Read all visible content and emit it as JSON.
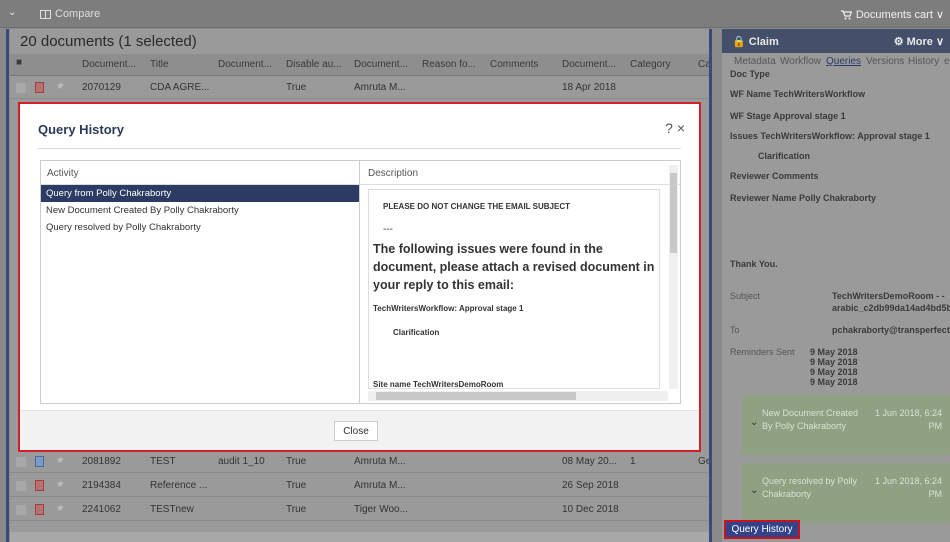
{
  "topbar": {
    "compare": "Compare",
    "cart": "Documents cart ∨",
    "collapse_glyph": "⌄",
    "cart_icon": "cart-icon"
  },
  "list": {
    "count": "20 documents (1 selected)",
    "columns": [
      "Document...",
      "Title",
      "Document...",
      "Disable au...",
      "Document...",
      "Reason fo...",
      "Comments",
      "Document...",
      "Category",
      "Ca"
    ],
    "top_rows": [
      [
        "2070129",
        "CDA AGRE...",
        "",
        "True",
        "Amruta M...",
        "",
        "",
        "18 Apr 2018",
        "",
        ""
      ]
    ],
    "bottom_rows": [
      [
        "2081892",
        "TEST",
        "audit 1_10",
        "True",
        "Amruta M...",
        "",
        "",
        "08 May 20...",
        "1",
        "Ge"
      ],
      [
        "2194384",
        "Reference ...",
        "",
        "True",
        "Amruta M...",
        "",
        "",
        "26 Sep 2018",
        "",
        ""
      ],
      [
        "2241062",
        "TESTnew",
        "",
        "True",
        "Tiger Woo...",
        "",
        "",
        "10 Dec 2018",
        "",
        ""
      ]
    ]
  },
  "panel": {
    "claim": "Claim",
    "more": "More ∨",
    "tabs": [
      "Metadata",
      "Workflow",
      "Queries",
      "Versions",
      "History",
      "e"
    ],
    "lines": [
      "Doc Type",
      "WF Name TechWritersWorkflow",
      "WF Stage Approval stage 1",
      "Issues TechWritersWorkflow: Approval stage 1",
      "Clarification",
      "Reviewer Comments",
      "Reviewer Name Polly Chakraborty",
      "Thank You."
    ],
    "subject_label": "Subject",
    "subject_value": [
      "TechWritersDemoRoom - -",
      "arabic_c2db99da14ad4bd5bf"
    ],
    "to_label": "To",
    "to_value": "pchakraborty@transperfect.",
    "reminders_label": "Reminders Sent",
    "reminders": [
      "9 May 2018",
      "9 May 2018",
      "9 May 2018",
      "9 May 2018"
    ],
    "cards": [
      {
        "text": "New Document Created By Polly Chakraborty",
        "time": "1 Jun 2018, 6:24 PM"
      },
      {
        "text": "Query resolved by Polly Chakraborty",
        "time": "1 Jun 2018, 6:24 PM"
      }
    ],
    "query_history_btn": "Query History"
  },
  "modal": {
    "title": "Query History",
    "tools": "? ×",
    "activity_header": "Activity",
    "description_header": "Description",
    "activities": [
      "Query from Polly Chakraborty",
      "New Document Created By Polly Chakraborty",
      "Query resolved by Polly Chakraborty"
    ],
    "desc": {
      "l1": "PLEASE DO NOT CHANGE THE EMAIL SUBJECT",
      "l2": "---",
      "l3": "The following issues were found in the document, please attach a revised document in your reply to this email:",
      "l4": "TechWritersWorkflow: Approval stage 1",
      "l5": "Clarification",
      "l6": "Site name TechWritersDemoRoom"
    },
    "close": "Close"
  }
}
